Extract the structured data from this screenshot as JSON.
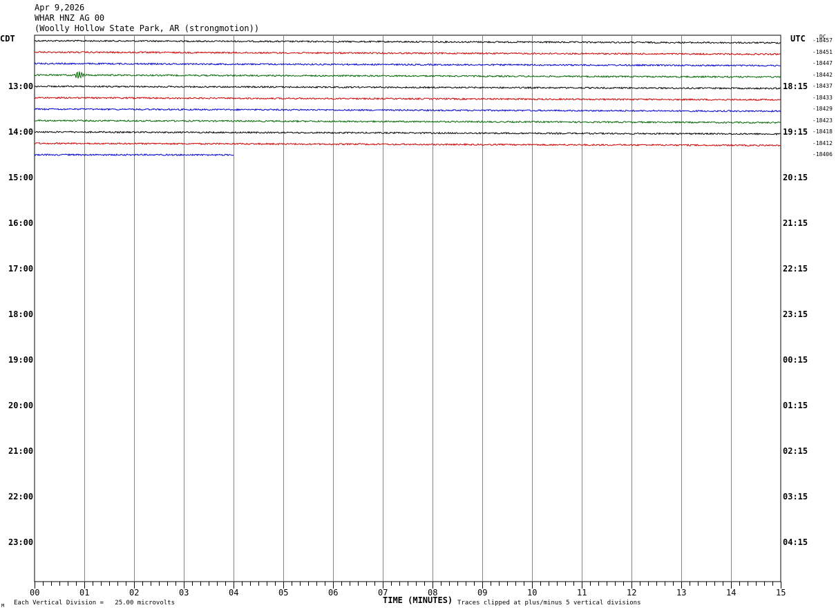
{
  "header": {
    "date": "Apr 9,2026",
    "station": "WHAR HNZ AG 00",
    "location": "(Woolly Hollow State Park, AR (strongmotion))"
  },
  "axes": {
    "left_zone": "CDT",
    "right_zone": "UTC",
    "dc_label": "DC",
    "xlabel": "TIME (MINUTES)"
  },
  "footer": {
    "scale_note": "Each Vertical Division =   25.00 microvolts",
    "clip_note": "Traces clipped at plus/minus 5 vertical divisions",
    "corner_mark": "M"
  },
  "colors": {
    "black": "#000000",
    "red": "#cc0000",
    "blue": "#0000cc",
    "green": "#006600",
    "grid": "#808080"
  },
  "chart_data": {
    "type": "line",
    "x_ticks": [
      "00",
      "01",
      "02",
      "03",
      "04",
      "05",
      "06",
      "07",
      "08",
      "09",
      "10",
      "11",
      "12",
      "13",
      "14",
      "15"
    ],
    "xlim": [
      0,
      15
    ],
    "left_hour_labels": [
      "13:00",
      "14:00",
      "15:00",
      "16:00",
      "17:00",
      "18:00",
      "19:00",
      "20:00",
      "21:00",
      "22:00",
      "23:00"
    ],
    "right_hour_labels": [
      "18:15",
      "19:15",
      "20:15",
      "21:15",
      "22:15",
      "23:15",
      "00:15",
      "01:15",
      "02:15",
      "03:15",
      "04:15"
    ],
    "traces": [
      {
        "row": 0,
        "color": "black",
        "dc": "-18457",
        "end_minute": 15,
        "drift": 3
      },
      {
        "row": 1,
        "color": "red",
        "dc": "-18451",
        "end_minute": 15,
        "drift": 3
      },
      {
        "row": 2,
        "color": "blue",
        "dc": "-18447",
        "end_minute": 15,
        "drift": 3
      },
      {
        "row": 3,
        "color": "green",
        "dc": "-18442",
        "end_minute": 15,
        "drift": 3,
        "event_minute": 0.9
      },
      {
        "row": 4,
        "color": "black",
        "dc": "-18437",
        "end_minute": 15,
        "drift": 3
      },
      {
        "row": 5,
        "color": "red",
        "dc": "-18433",
        "end_minute": 15,
        "drift": 3
      },
      {
        "row": 6,
        "color": "blue",
        "dc": "-18429",
        "end_minute": 15,
        "drift": 3
      },
      {
        "row": 7,
        "color": "green",
        "dc": "-18423",
        "end_minute": 15,
        "drift": 3
      },
      {
        "row": 8,
        "color": "black",
        "dc": "-18418",
        "end_minute": 15,
        "drift": 3
      },
      {
        "row": 9,
        "color": "red",
        "dc": "-18412",
        "end_minute": 15,
        "drift": 3
      },
      {
        "row": 10,
        "color": "blue",
        "dc": "-18406",
        "end_minute": 4,
        "drift": 1
      }
    ]
  }
}
